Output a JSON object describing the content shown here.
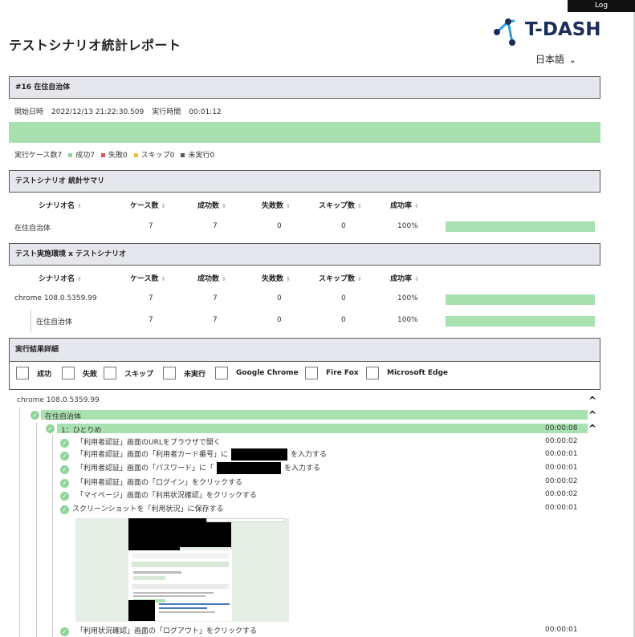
{
  "header": {
    "log_label": "Log",
    "page_title": "テストシナリオ統計レポート",
    "logo_text": "T-DASH",
    "language": "日本語",
    "language_chevron": "⌄"
  },
  "run": {
    "title": "#16 在住自治体",
    "start_label": "開始日時",
    "start_value": "2022/12/13 21:22:30.509",
    "duration_label": "実行時間",
    "duration_value": "00:01:12"
  },
  "legend": {
    "cases": "実行ケース数7",
    "success": "成功7",
    "failure": "失敗0",
    "skip": "スキップ0",
    "not_run": "未実行0",
    "colors": {
      "success": "#8fd49a",
      "failure": "#e05757",
      "skip": "#e8c23a",
      "not_run": "#555555"
    }
  },
  "summary": {
    "title": "テストシナリオ 統計サマリ",
    "columns": [
      "シナリオ名",
      "ケース数",
      "成功数",
      "失敗数",
      "スキップ数",
      "成功率"
    ],
    "sort_icon": "⇕",
    "rows": [
      {
        "name": "在住自治体",
        "cases": "7",
        "success": "7",
        "failure": "0",
        "skip": "0",
        "rate": "100%",
        "rate_value": 1.0
      }
    ]
  },
  "env": {
    "title": "テスト実施環境 x テストシナリオ",
    "columns": [
      "シナリオ名",
      "ケース数",
      "成功数",
      "失敗数",
      "スキップ数",
      "成功率"
    ],
    "rows": [
      {
        "name": "chrome 108.0.5359.99",
        "cases": "7",
        "success": "7",
        "failure": "0",
        "skip": "0",
        "rate": "100%",
        "rate_value": 1.0
      },
      {
        "name": "在住自治体",
        "cases": "7",
        "success": "7",
        "failure": "0",
        "skip": "0",
        "rate": "100%",
        "rate_value": 1.0
      }
    ]
  },
  "details": {
    "title": "実行結果詳細",
    "filters": [
      "成功",
      "失敗",
      "スキップ",
      "未実行",
      "Google Chrome",
      "Fire Fox",
      "Microsoft Edge"
    ],
    "browser": "chrome 108.0.5359.99",
    "scenario": "在住自治体",
    "case": "1：ひとりめ",
    "case_time": "00:00:08",
    "steps": [
      {
        "pre": "「利用者認証」画面のURLをブラウザで開く",
        "post": "",
        "time": "00:00:02"
      },
      {
        "pre": "「利用者認証」画面の「利用者カード番号」に",
        "post": "を入力する",
        "time": "00:00:01"
      },
      {
        "pre": "「利用者認証」画面の「パスワード」に「",
        "post": "を入力する",
        "time": "00:00:01"
      },
      {
        "pre": "「利用者認証」画面の「ログイン」をクリックする",
        "post": "",
        "time": "00:00:02"
      },
      {
        "pre": "「マイページ」画面の「利用状況確認」をクリックする",
        "post": "",
        "time": "00:00:02"
      },
      {
        "pre": "スクリーンショットを「利用状況」に保存する",
        "post": "",
        "time": "00:00:01"
      },
      {
        "pre": "「利用状況確認」画面の「ログアウト」をクリックする",
        "post": "",
        "time": "00:00:01"
      }
    ],
    "check_glyph": "✓",
    "caret_glyph": "^"
  }
}
